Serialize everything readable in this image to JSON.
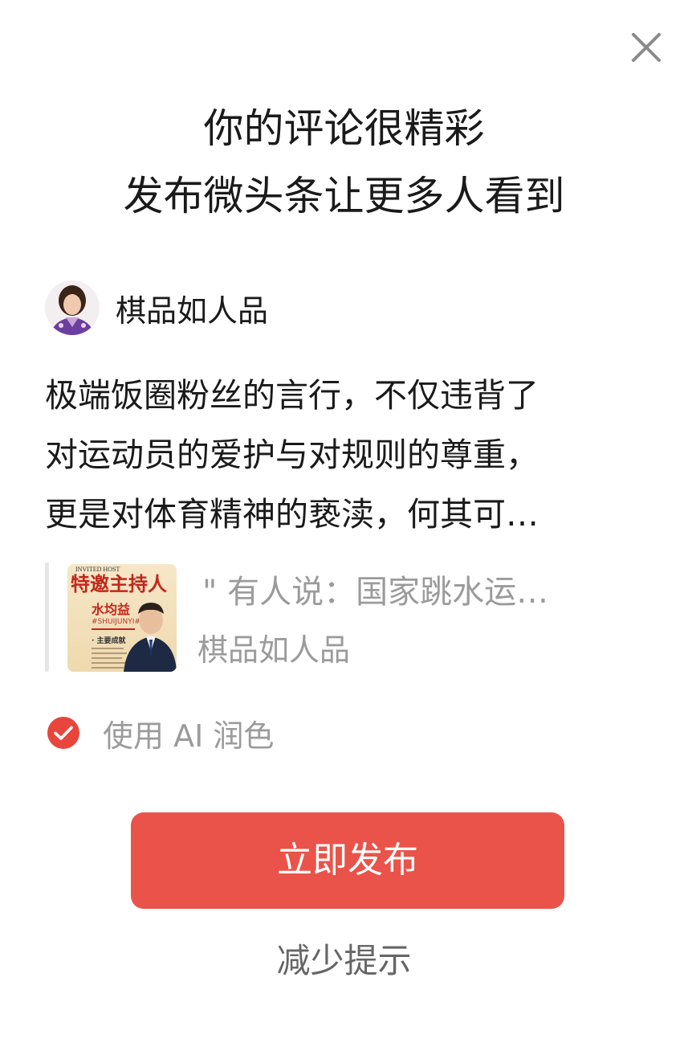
{
  "dialog": {
    "close_icon": "close-icon",
    "title_line1": "你的评论很精彩",
    "title_line2": "发布微头条让更多人看到"
  },
  "author": {
    "name": "棋品如人品",
    "avatar_icon": "avatar"
  },
  "comment": {
    "line1": "极端饭圈粉丝的言行，不仅违背了",
    "line2": "对运动员的爱护与对规则的尊重，",
    "line3": "更是对体育精神的亵渎，何其可…"
  },
  "quote": {
    "thumb_title": "特邀主持人",
    "thumb_name": "水均益",
    "thumb_sub": "#SHUIJUNYI#",
    "thumb_top": "INVITED HOST",
    "thumb_section": "· 主要成就",
    "text": "\" 有人说：国家跳水运…",
    "author": "棋品如人品"
  },
  "ai_option": {
    "checked": true,
    "label": "使用 AI 润色",
    "check_color": "#e8453c"
  },
  "actions": {
    "publish_label": "立即发布",
    "publish_color": "#ea5349",
    "reduce_label": "减少提示"
  }
}
